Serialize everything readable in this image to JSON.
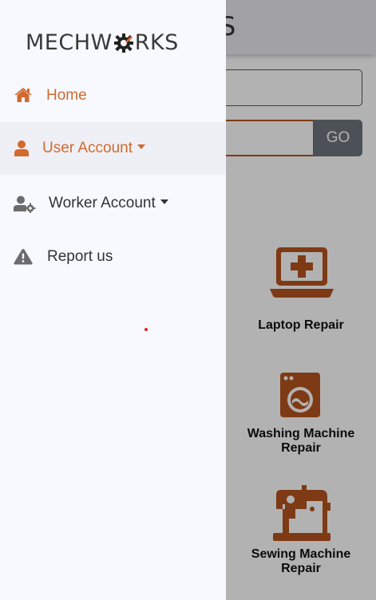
{
  "app": {
    "brand_prefix": "MECHW",
    "brand_suffix": "RKS",
    "header_fragment": "KS"
  },
  "search": {
    "go_label": "GO"
  },
  "services": [
    {
      "label": "Laptop Repair",
      "icon": "laptop-medical-icon"
    },
    {
      "label": "Washing Machine Repair",
      "icon": "washing-machine-icon"
    },
    {
      "label": "Sewing Machine Repair",
      "icon": "sewing-machine-icon"
    }
  ],
  "partial_text": "r",
  "drawer": {
    "items": [
      {
        "label": "Home",
        "icon": "home-icon",
        "has_dropdown": false
      },
      {
        "label": "User Account",
        "icon": "user-icon",
        "has_dropdown": true
      },
      {
        "label": "Worker Account",
        "icon": "user-gear-icon",
        "has_dropdown": true
      },
      {
        "label": "Report us",
        "icon": "warning-icon",
        "has_dropdown": false
      }
    ]
  },
  "colors": {
    "accent": "#d2692f",
    "service_icon": "#b5531d",
    "text": "#333333",
    "icon_gray": "#6c6c6c",
    "go_button": "#6c757d"
  }
}
